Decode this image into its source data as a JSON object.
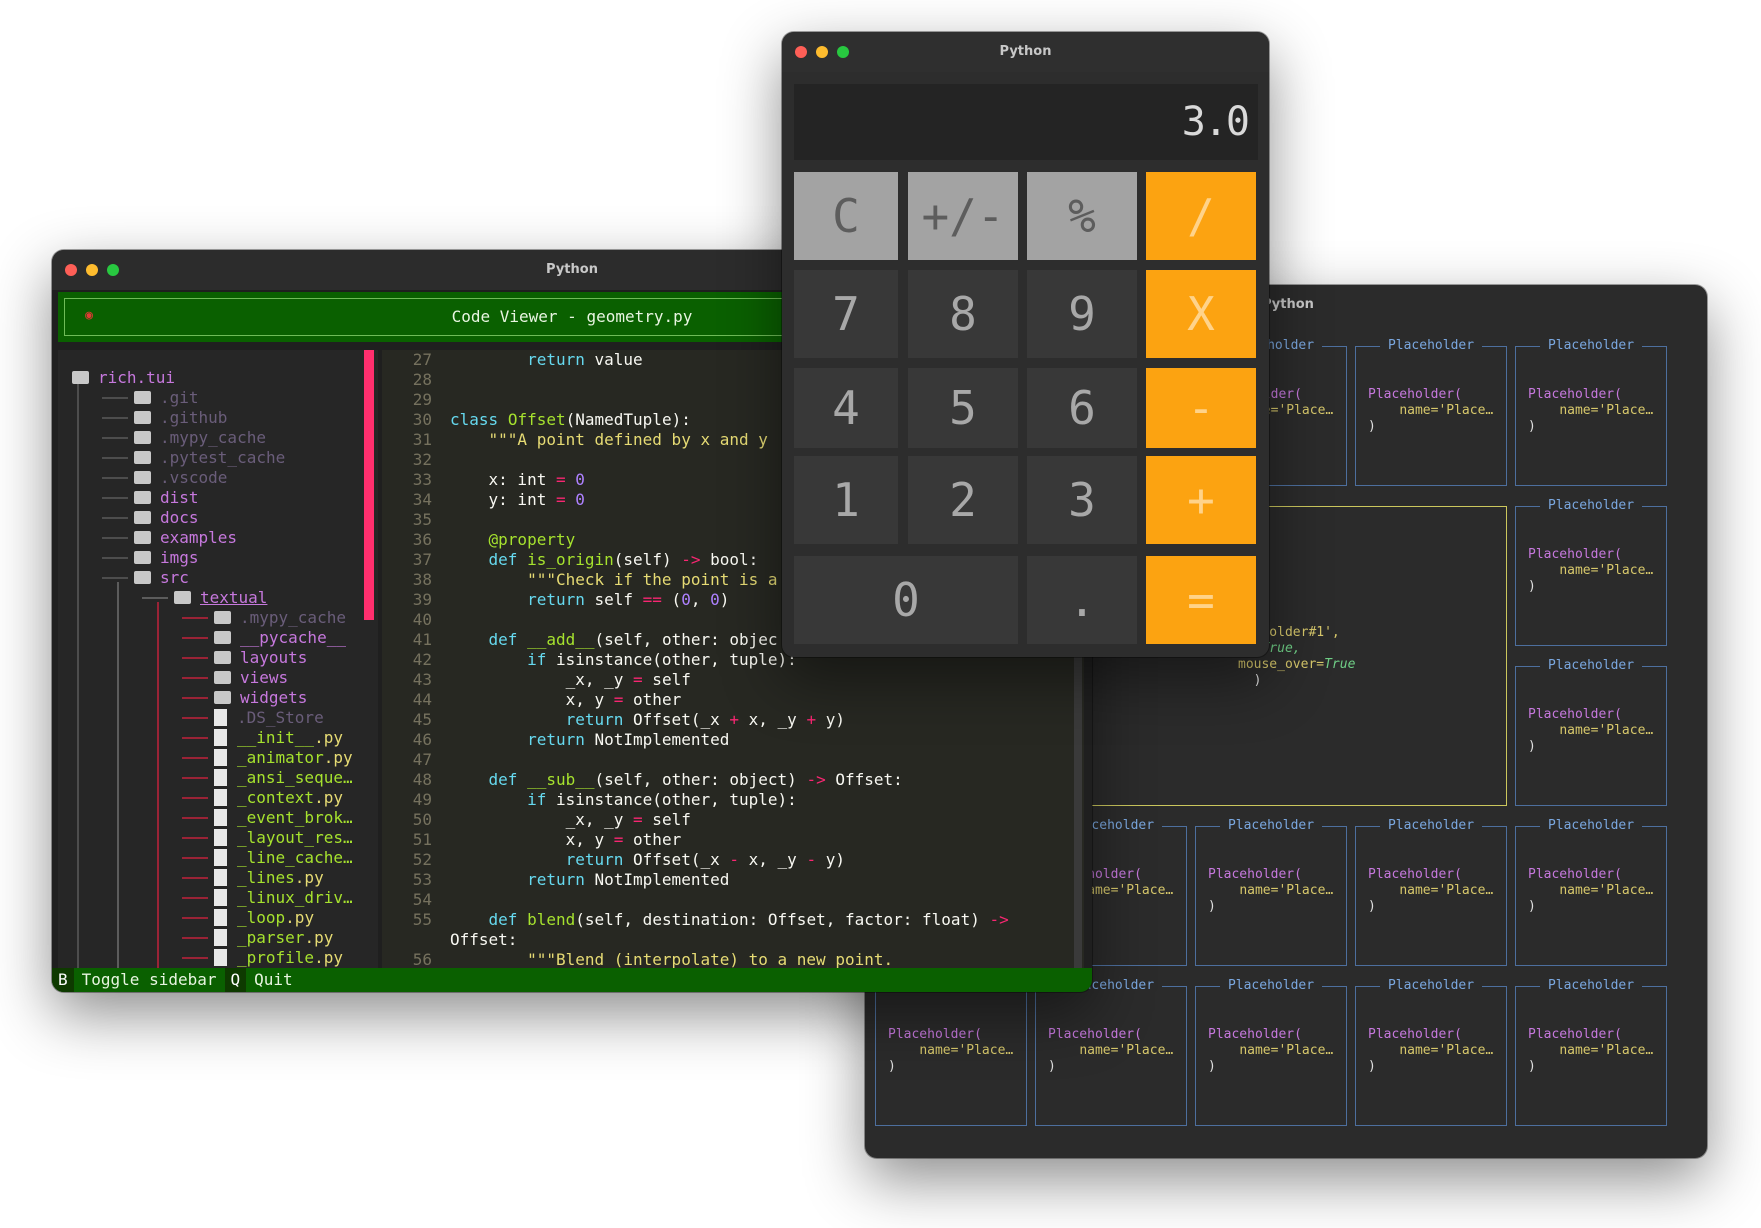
{
  "placeholder_window": {
    "title": "Python",
    "placeholder_label": "Placeholder",
    "code_fn": "Placeholder(",
    "code_arg": "name='Place…",
    "code_close": ")",
    "big": {
      "line1": "aceholder#1',",
      "line2_prefix": "_",
      "line2_kw": "s=",
      "line2_val": "True,",
      "line3_kw": "mouse_over=",
      "line3_val": "True",
      "line4": ")"
    }
  },
  "code_viewer": {
    "title": "Python",
    "header": "Code Viewer - geometry.py",
    "tree_root": "rich.tui",
    "tree": [
      {
        "name": ".git",
        "kind": "folder",
        "level": 1,
        "dim": true
      },
      {
        "name": ".github",
        "kind": "folder",
        "level": 1,
        "dim": true
      },
      {
        "name": ".mypy_cache",
        "kind": "folder",
        "level": 1,
        "dim": true
      },
      {
        "name": ".pytest_cache",
        "kind": "folder",
        "level": 1,
        "dim": true
      },
      {
        "name": ".vscode",
        "kind": "folder",
        "level": 1,
        "dim": true
      },
      {
        "name": "dist",
        "kind": "folder",
        "level": 1,
        "dim": false
      },
      {
        "name": "docs",
        "kind": "folder",
        "level": 1,
        "dim": false
      },
      {
        "name": "examples",
        "kind": "folder",
        "level": 1,
        "dim": false
      },
      {
        "name": "imgs",
        "kind": "folder",
        "level": 1,
        "dim": false
      },
      {
        "name": "src",
        "kind": "folder",
        "level": 1,
        "dim": false
      },
      {
        "name": "textual",
        "kind": "folder",
        "level": 2,
        "dim": false
      },
      {
        "name": ".mypy_cache",
        "kind": "folder",
        "level": 3,
        "dim": true
      },
      {
        "name": "__pycache__",
        "kind": "folder",
        "level": 3,
        "dim": false
      },
      {
        "name": "layouts",
        "kind": "folder",
        "level": 3,
        "dim": false
      },
      {
        "name": "views",
        "kind": "folder",
        "level": 3,
        "dim": false
      },
      {
        "name": "widgets",
        "kind": "folder",
        "level": 3,
        "dim": false
      },
      {
        "name": ".DS_Store",
        "kind": "file",
        "level": 3,
        "dim": true
      },
      {
        "name": "__init__",
        "ext": ".py",
        "kind": "file",
        "level": 3
      },
      {
        "name": "_animator",
        "ext": ".py",
        "kind": "file",
        "level": 3
      },
      {
        "name": "_ansi_seque…",
        "kind": "file",
        "level": 3
      },
      {
        "name": "_context",
        "ext": ".py",
        "kind": "file",
        "level": 3
      },
      {
        "name": "_event_brok…",
        "kind": "file",
        "level": 3
      },
      {
        "name": "_layout_res…",
        "kind": "file",
        "level": 3
      },
      {
        "name": "_line_cache…",
        "kind": "file",
        "level": 3
      },
      {
        "name": "_lines",
        "ext": ".py",
        "kind": "file",
        "level": 3
      },
      {
        "name": "_linux_driv…",
        "kind": "file",
        "level": 3
      },
      {
        "name": "_loop",
        "ext": ".py",
        "kind": "file",
        "level": 3
      },
      {
        "name": "_parser",
        "ext": ".py",
        "kind": "file",
        "level": 3
      },
      {
        "name": "_profile",
        "ext": ".py",
        "kind": "file",
        "level": 3
      }
    ],
    "code_lines": [
      {
        "n": "27",
        "t": "        <span class='k'>return</span> value"
      },
      {
        "n": "28",
        "t": ""
      },
      {
        "n": "29",
        "t": ""
      },
      {
        "n": "30",
        "t": "<span class='k'>class</span> <span class='c'>Offset</span>(NamedTuple):"
      },
      {
        "n": "31",
        "t": "    <span class='s'>\"\"\"A point defined by x and y</span>"
      },
      {
        "n": "32",
        "t": ""
      },
      {
        "n": "33",
        "t": "    x: int <span class='o'>=</span> <span class='n'>0</span>"
      },
      {
        "n": "34",
        "t": "    y: int <span class='o'>=</span> <span class='n'>0</span>"
      },
      {
        "n": "35",
        "t": ""
      },
      {
        "n": "36",
        "t": "    <span class='c'>@property</span>"
      },
      {
        "n": "37",
        "t": "    <span class='k'>def</span> <span class='c'>is_origin</span>(self) <span class='o'>-></span> bool:"
      },
      {
        "n": "38",
        "t": "        <span class='s'>\"\"\"Check if the point is a</span>"
      },
      {
        "n": "39",
        "t": "        <span class='k'>return</span> self <span class='o'>==</span> (<span class='n'>0</span>, <span class='n'>0</span>)"
      },
      {
        "n": "40",
        "t": ""
      },
      {
        "n": "41",
        "t": "    <span class='k'>def</span> <span class='c'>__add__</span>(self, other: objec"
      },
      {
        "n": "42",
        "t": "        <span class='k'>if</span> isinstance(other, tuple):"
      },
      {
        "n": "43",
        "t": "            _x, _y <span class='o'>=</span> self"
      },
      {
        "n": "44",
        "t": "            x, y <span class='o'>=</span> other"
      },
      {
        "n": "45",
        "t": "            <span class='k'>return</span> Offset(_x <span class='o'>+</span> x, _y <span class='o'>+</span> y)"
      },
      {
        "n": "46",
        "t": "        <span class='k'>return</span> NotImplemented"
      },
      {
        "n": "47",
        "t": ""
      },
      {
        "n": "48",
        "t": "    <span class='k'>def</span> <span class='c'>__sub__</span>(self, other: object) <span class='o'>-></span> Offset:"
      },
      {
        "n": "49",
        "t": "        <span class='k'>if</span> isinstance(other, tuple):"
      },
      {
        "n": "50",
        "t": "            _x, _y <span class='o'>=</span> self"
      },
      {
        "n": "51",
        "t": "            x, y <span class='o'>=</span> other"
      },
      {
        "n": "52",
        "t": "            <span class='k'>return</span> Offset(_x <span class='o'>-</span> x, _y <span class='o'>-</span> y)"
      },
      {
        "n": "53",
        "t": "        <span class='k'>return</span> NotImplemented"
      },
      {
        "n": "54",
        "t": ""
      },
      {
        "n": "55",
        "t": "    <span class='k'>def</span> <span class='c'>blend</span>(self, destination: Offset, factor: float) <span class='o'>-></span>"
      },
      {
        "n": "",
        "t": "Offset:"
      },
      {
        "n": "56",
        "t": "        <span class='s'>\"\"\"Blend (interpolate) to a new point.</span>"
      }
    ],
    "footer": {
      "toggle_key": "B",
      "toggle_label": "Toggle sidebar",
      "quit_key": "Q",
      "quit_label": "Quit"
    }
  },
  "calculator": {
    "title": "Python",
    "display": "3.0",
    "buttons": [
      {
        "label": "C",
        "style": "gray"
      },
      {
        "label": "+/-",
        "style": "gray"
      },
      {
        "label": "%",
        "style": "gray"
      },
      {
        "label": "/",
        "style": "orange"
      },
      {
        "label": "7",
        "style": "dark"
      },
      {
        "label": "8",
        "style": "dark"
      },
      {
        "label": "9",
        "style": "dark"
      },
      {
        "label": "X",
        "style": "orange"
      },
      {
        "label": "4",
        "style": "dark"
      },
      {
        "label": "5",
        "style": "dark"
      },
      {
        "label": "6",
        "style": "dark"
      },
      {
        "label": "-",
        "style": "orange"
      },
      {
        "label": "1",
        "style": "dark"
      },
      {
        "label": "2",
        "style": "dark"
      },
      {
        "label": "3",
        "style": "dark"
      },
      {
        "label": "+",
        "style": "orange"
      },
      {
        "label": "0",
        "style": "dark"
      },
      {
        "label": ".",
        "style": "dark"
      },
      {
        "label": "=",
        "style": "orange"
      }
    ]
  },
  "colors": {
    "accent_orange": "#fca311",
    "header_green": "#0a6000",
    "scroll_pink": "#ff2f6e",
    "placeholder_border": "#4d6f9e",
    "placeholder_focus_border": "#cbc75d"
  }
}
